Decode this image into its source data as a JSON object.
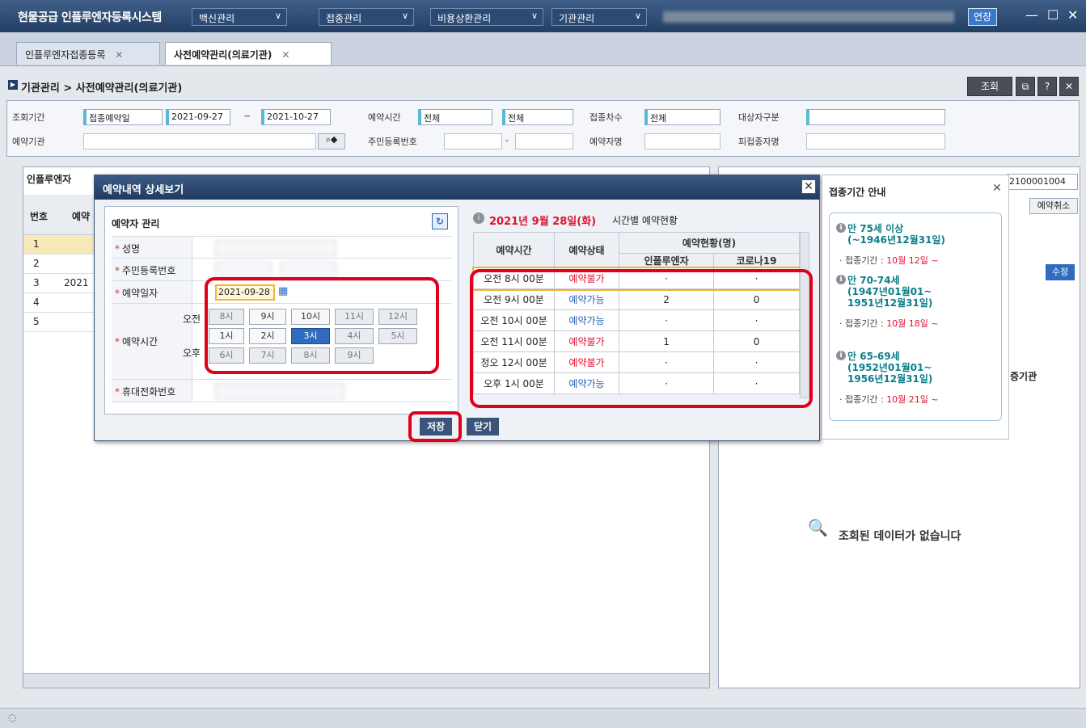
{
  "app": {
    "title": "현물공급 인플루엔자등록시스템",
    "extend": "연장",
    "minimize": "—",
    "maximize": "☐",
    "close": "✕"
  },
  "menu": [
    "백신관리",
    "접종관리",
    "비용상환관리",
    "기관관리"
  ],
  "tabs": [
    {
      "label": "인플루엔자접종등록",
      "close": "✕"
    },
    {
      "label": "사전예약관리(의료기관)",
      "close": "✕"
    }
  ],
  "breadcrumb": "기관관리 > 사전예약관리(의료기관)",
  "toolbar": {
    "search": "조회"
  },
  "filters": {
    "period_label": "조회기간",
    "period_type": "접종예약일",
    "date_from": "2021-09-27",
    "date_sep": "~",
    "date_to": "2021-10-27",
    "time_label": "예약시간",
    "time_from": "전체",
    "time_to": "전체",
    "round_label": "접종차수",
    "round_value": "전체",
    "target_label": "대상자구분",
    "target_value": "",
    "org_label": "예약기관",
    "rrn_label": "주민등록번호",
    "rrn_sep": "-",
    "reserver_label": "예약자명",
    "vaccinee_label": "피접종자명"
  },
  "left_panel": {
    "title": "인플루엔자",
    "cols": [
      "번호",
      "예약"
    ],
    "rows": [
      "1",
      "2",
      "3",
      "4",
      "5"
    ],
    "row3_value": "2021"
  },
  "right_panel": {
    "code": "2100001004",
    "btn_cancel": "예약취소",
    "btn_edit": "수정",
    "btn_label": "증기관",
    "nodata": "조회된 데이터가 없습니다"
  },
  "dialog": {
    "title": "예약내역 상세보기",
    "section": "예약자 관리",
    "refresh": "↻",
    "fields": {
      "name": "성명",
      "rrn": "주민등록번호",
      "date_label": "예약일자",
      "date_value": "2021-09-28",
      "time_label": "예약시간",
      "phone": "휴대전화번호",
      "am": "오전",
      "pm": "오후"
    },
    "am_hours": [
      "8시",
      "9시",
      "10시",
      "11시",
      "12시"
    ],
    "pm_hours": [
      "1시",
      "2시",
      "3시",
      "4시",
      "5시",
      "6시",
      "7시",
      "8시",
      "9시"
    ],
    "status_title": "2021년 9월 28일(화)",
    "status_suffix": "시간별 예약현황",
    "table_headers": {
      "time": "예약시간",
      "status": "예약상태",
      "count": "예약현황(명)",
      "flu": "인플루엔자",
      "covid": "코로나19"
    },
    "rows": [
      {
        "time": "오전 8시 00분",
        "status": "예약불가",
        "flu": "·",
        "covid": "·"
      },
      {
        "time": "오전 9시 00분",
        "status": "예약가능",
        "flu": "2",
        "covid": "0"
      },
      {
        "time": "오전 10시 00분",
        "status": "예약가능",
        "flu": "·",
        "covid": "·"
      },
      {
        "time": "오전 11시 00분",
        "status": "예약불가",
        "flu": "1",
        "covid": "0"
      },
      {
        "time": "정오 12시 00분",
        "status": "예약불가",
        "flu": "·",
        "covid": "·"
      },
      {
        "time": "오후 1시 00분",
        "status": "예약가능",
        "flu": "·",
        "covid": "·"
      }
    ],
    "save": "저장",
    "close": "닫기"
  },
  "guide": {
    "title": "접종기간 안내",
    "close": "✕",
    "groups": [
      {
        "line1": "만 75세 이상",
        "line2": "(~1946년12월31일)",
        "period_label": "접종기간 : ",
        "period": "10월 12일 ~"
      },
      {
        "line1": "만 70-74세",
        "line2": "(1947년01월01~",
        "line3": "1951년12월31일)",
        "period_label": "접종기간 : ",
        "period": "10월 18일 ~"
      },
      {
        "line1": "만 65-69세",
        "line2": "(1952년01월01~",
        "line3": "1956년12월31일)",
        "period_label": "접종기간 : ",
        "period": "10월 21일 ~"
      }
    ]
  }
}
